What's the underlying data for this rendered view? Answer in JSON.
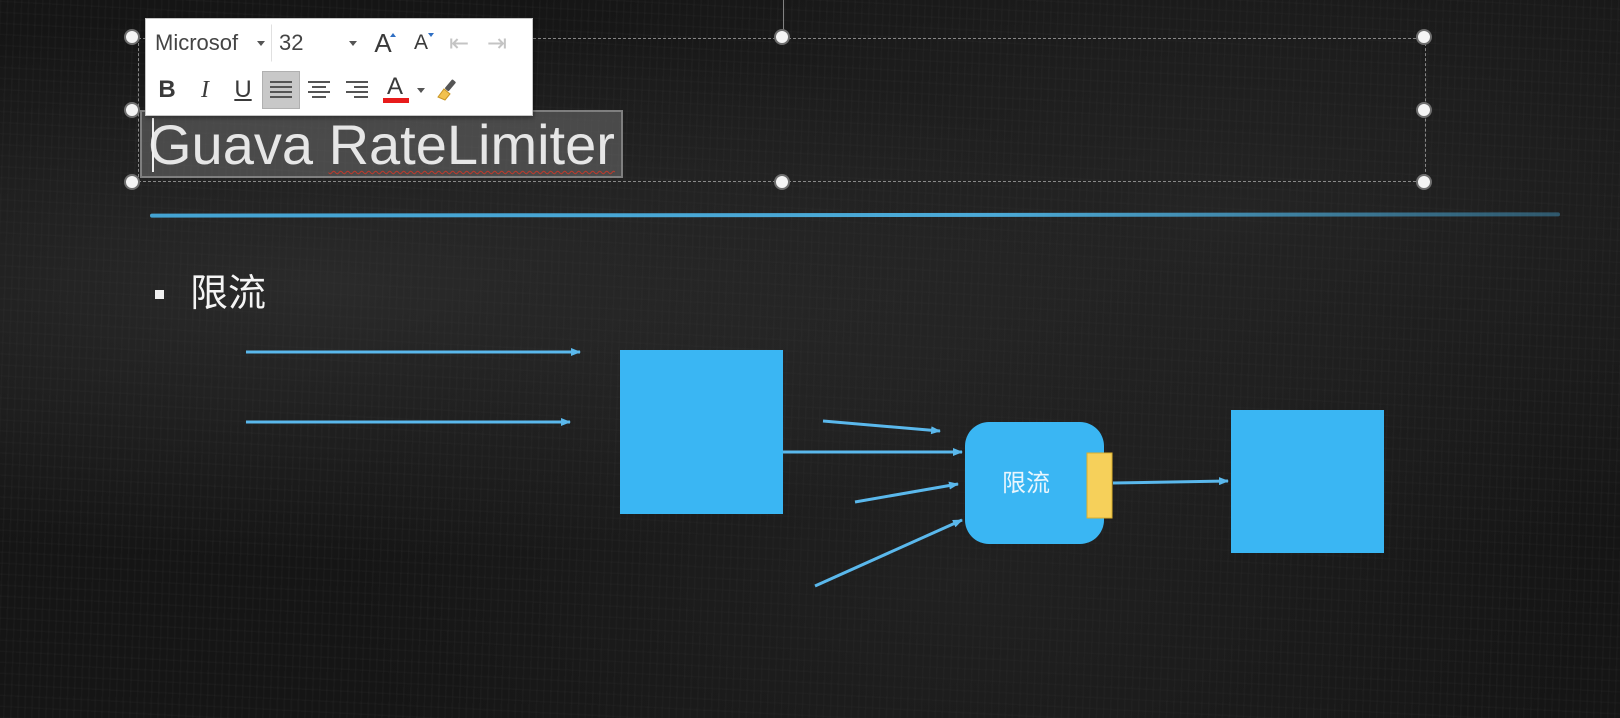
{
  "toolbar": {
    "font_name": "Microsof",
    "font_size": "32",
    "grow_font_label": "A",
    "shrink_font_label": "A",
    "decrease_indent_label": "⇤",
    "increase_indent_label": "⇥",
    "bold_label": "B",
    "italic_label": "I",
    "underline_label": "U",
    "font_color_label": "A",
    "font_color": "#e81b1b",
    "active_alignment": "left"
  },
  "slide": {
    "title": "Guava RateLimiter",
    "title_spellcheck_word": "RateLimiter",
    "bullet": "限流",
    "accent_color": "#3ab6f3",
    "rule_color": "#46aadc"
  },
  "diagram": {
    "limiter_label": "限流",
    "box_color": "#3ab6f3",
    "gate_color": "#f6d05a",
    "arrow_color": "#5ab8ec"
  }
}
